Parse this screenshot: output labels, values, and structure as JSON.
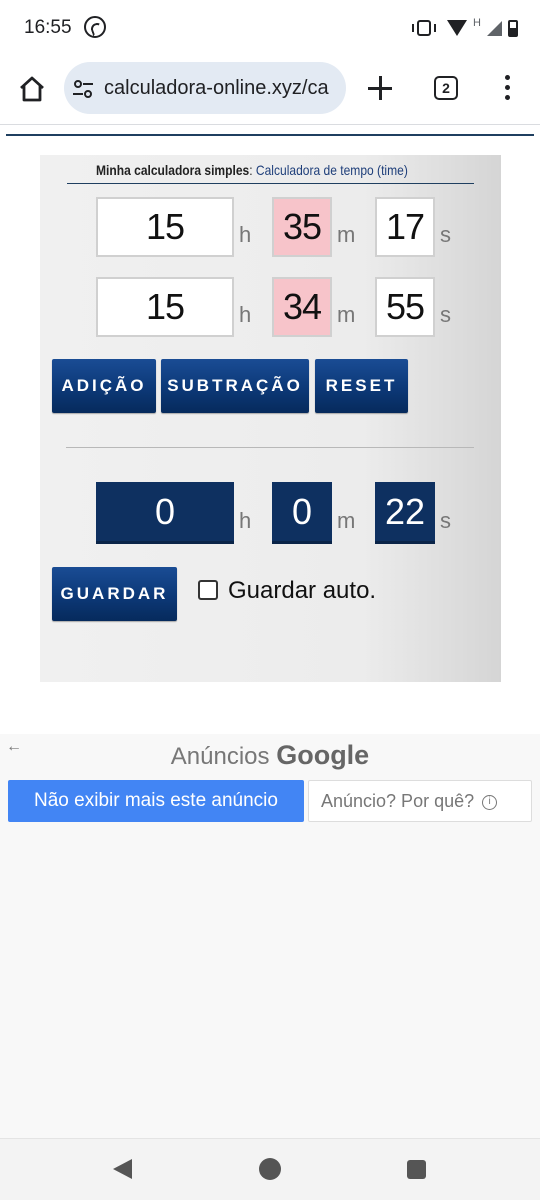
{
  "status_bar": {
    "time": "16:55",
    "network_label": "H"
  },
  "browser": {
    "url": "calculadora-online.xyz/ca",
    "tab_count": "2"
  },
  "calculator": {
    "title_bold": "Minha calculadora simples",
    "title_sep": ": ",
    "title_sub": "Calculadora de tempo (time)",
    "time1": {
      "h": "15",
      "m": "35",
      "s": "17"
    },
    "time2": {
      "h": "15",
      "m": "34",
      "s": "55"
    },
    "units": {
      "h": "h",
      "m": "m",
      "s": "s"
    },
    "buttons": {
      "add": "ADIÇÃO",
      "subtract": "SUBTRAÇÃO",
      "reset": "RESET",
      "save": "GUARDAR"
    },
    "result": {
      "h": "0",
      "m": "0",
      "s": "22"
    },
    "auto_save_label": "Guardar auto.",
    "auto_save_checked": false
  },
  "ads": {
    "back_arrow": "←",
    "title_prefix": "Anúncios ",
    "title_brand": "Google",
    "hide_ad_label": "Não exibir mais este anúncio",
    "why_ad_label": "Anúncio? Por quê?",
    "info_glyph": "i"
  },
  "colors": {
    "accent_navy": "#0e3060",
    "pink": "#f7c4ca",
    "ad_blue": "#4285f4"
  }
}
